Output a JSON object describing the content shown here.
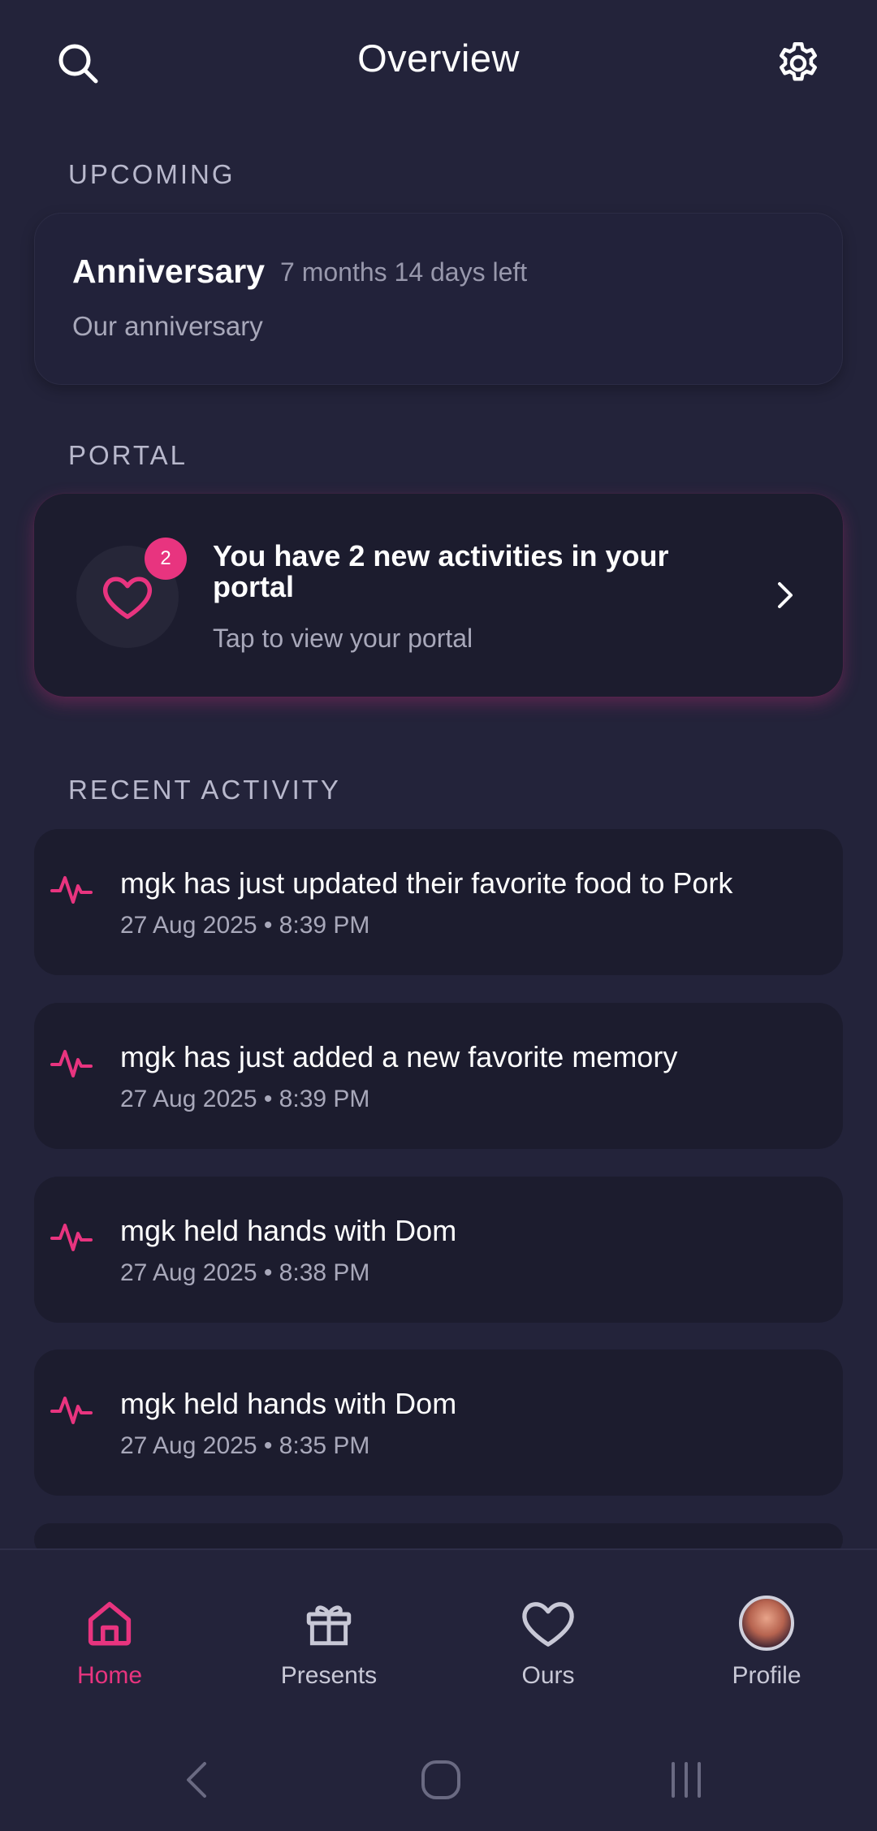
{
  "header": {
    "title": "Overview",
    "search_icon": "search-icon",
    "settings_icon": "gear-icon"
  },
  "sections": {
    "upcoming": "UPCOMING",
    "portal": "PORTAL",
    "recent": "RECENT ACTIVITY"
  },
  "upcoming": {
    "title": "Anniversary",
    "remaining": "7 months 14 days left",
    "description": "Our anniversary"
  },
  "portal": {
    "badge_count": "2",
    "title": "You have 2 new activities in your portal",
    "subtitle": "Tap to view your portal"
  },
  "activities": [
    {
      "text": "mgk has just updated their favorite food to Pork",
      "time": "27 Aug 2025 • 8:39 PM"
    },
    {
      "text": "mgk has just added a new favorite memory",
      "time": "27 Aug 2025 • 8:39 PM"
    },
    {
      "text": "mgk held hands with Dom",
      "time": "27 Aug 2025 • 8:38 PM"
    },
    {
      "text": "mgk held hands with Dom",
      "time": "27 Aug 2025 • 8:35 PM"
    }
  ],
  "nav": [
    {
      "label": "Home",
      "icon": "home-icon",
      "active": true
    },
    {
      "label": "Presents",
      "icon": "gift-icon",
      "active": false
    },
    {
      "label": "Ours",
      "icon": "heart-icon",
      "active": false
    },
    {
      "label": "Profile",
      "icon": "avatar",
      "active": false
    }
  ],
  "colors": {
    "background": "#23233a",
    "card": "#1c1c2e",
    "accent": "#e8347f",
    "muted_text": "#a8a8ba"
  }
}
